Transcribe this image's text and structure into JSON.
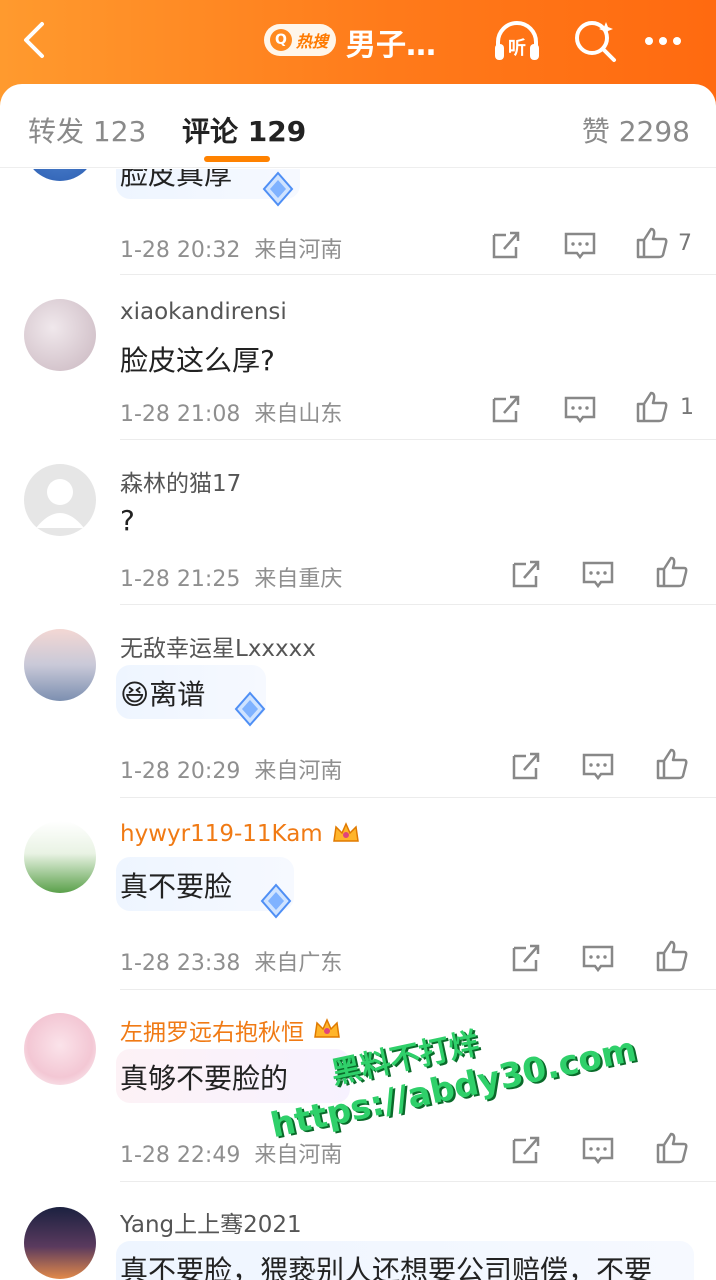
{
  "header": {
    "hot_badge": "热搜",
    "title": "男子…",
    "listen_label": "听",
    "accent_color": "#ff7a1a"
  },
  "tabs": {
    "forward": "转发 123",
    "comments": "评论 129",
    "likes": "赞 2298"
  },
  "comments": [
    {
      "username": "",
      "text": "脸皮真厚",
      "time": "1-28 20:32",
      "location": "来自河南",
      "likes": "7",
      "has_gem": true
    },
    {
      "username": "xiaokandirensi",
      "text": "脸皮这么厚?",
      "time": "1-28 21:08",
      "location": "来自山东",
      "likes": "1",
      "has_gem": false
    },
    {
      "username": "森林的猫17",
      "text": "?",
      "time": "1-28 21:25",
      "location": "来自重庆",
      "likes": "",
      "has_gem": false
    },
    {
      "username": "无敌幸运星Lxxxxx",
      "text": "😆离谱",
      "time": "1-28 20:29",
      "location": "来自河南",
      "likes": "",
      "has_gem": true
    },
    {
      "username": "hywyr119-11Kam",
      "text": "真不要脸",
      "time": "1-28 23:38",
      "location": "来自广东",
      "likes": "",
      "has_gem": true,
      "vip": true
    },
    {
      "username": "左拥罗远右抱秋恒",
      "text": "真够不要脸的",
      "time": "1-28 22:49",
      "location": "来自河南",
      "likes": "",
      "has_gem": false,
      "vip": true
    },
    {
      "username": "Yang上上骞2021",
      "text": "真不要脸，猥亵别人还想要公司赔偿，不要",
      "time": "",
      "location": "",
      "likes": "",
      "has_gem": false
    }
  ],
  "watermark": {
    "line1": "黑料不打烊",
    "line2": "https://abdy30.com"
  }
}
